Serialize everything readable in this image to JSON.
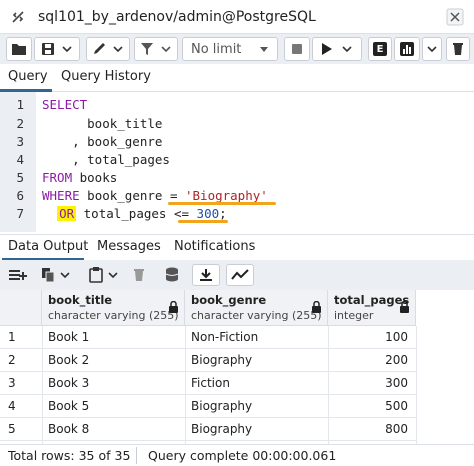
{
  "connection": {
    "label": "sql101_by_ardenov/admin@PostgreSQL",
    "icon": "connection-icon",
    "close_icon": "close-icon"
  },
  "toolbar": {
    "limit_label": "No limit",
    "explain_label": "E",
    "icons": [
      "folder-icon",
      "save-icon",
      "chevron-down-icon",
      "pen-icon",
      "filter-icon",
      "stop-icon",
      "play-icon",
      "chart-icon",
      "delete-icon"
    ]
  },
  "query_tabs": [
    {
      "label": "Query",
      "active": true
    },
    {
      "label": "Query History",
      "active": false
    }
  ],
  "editor": {
    "line_numbers": [
      "1",
      "2",
      "3",
      "4",
      "5",
      "6",
      "7"
    ],
    "lines": {
      "l1_kw": "SELECT",
      "l2": "      book_title",
      "l3": "    , book_genre",
      "l4": "    , total_pages",
      "l5_kw": "FROM",
      "l5_rest": " books",
      "l6_kw": "WHERE",
      "l6_mid": " book_genre = ",
      "l6_str": "'Biography'",
      "l7_kw": "OR",
      "l7_mid": " total_pages <= ",
      "l7_num": "300",
      "l7_end": ";"
    },
    "highlight_color": "#fff200",
    "underline_color": "#f2a51a"
  },
  "result_tabs": [
    {
      "label": "Data Output",
      "active": true
    },
    {
      "label": "Messages",
      "active": false
    },
    {
      "label": "Notifications",
      "active": false
    }
  ],
  "result_toolbar": {
    "icons": [
      "add-row-icon",
      "copy-icon",
      "chevron-down-icon",
      "paste-icon",
      "chevron-down-icon",
      "trash-icon",
      "database-icon",
      "download-icon",
      "graph-icon"
    ]
  },
  "grid": {
    "columns": [
      {
        "name": "book_title",
        "type": "character varying (255)"
      },
      {
        "name": "book_genre",
        "type": "character varying (255)"
      },
      {
        "name": "total_pages",
        "type": "integer"
      }
    ],
    "rows": [
      {
        "n": "1",
        "title": "Book 1",
        "genre": "Non-Fiction",
        "pages": "100"
      },
      {
        "n": "2",
        "title": "Book 2",
        "genre": "Biography",
        "pages": "200"
      },
      {
        "n": "3",
        "title": "Book 3",
        "genre": "Fiction",
        "pages": "300"
      },
      {
        "n": "4",
        "title": "Book 5",
        "genre": "Biography",
        "pages": "500"
      },
      {
        "n": "5",
        "title": "Book 8",
        "genre": "Biography",
        "pages": "800"
      }
    ]
  },
  "status": {
    "total_rows": "Total rows: 35 of 35",
    "query_complete": "Query complete 00:00:00.061"
  }
}
